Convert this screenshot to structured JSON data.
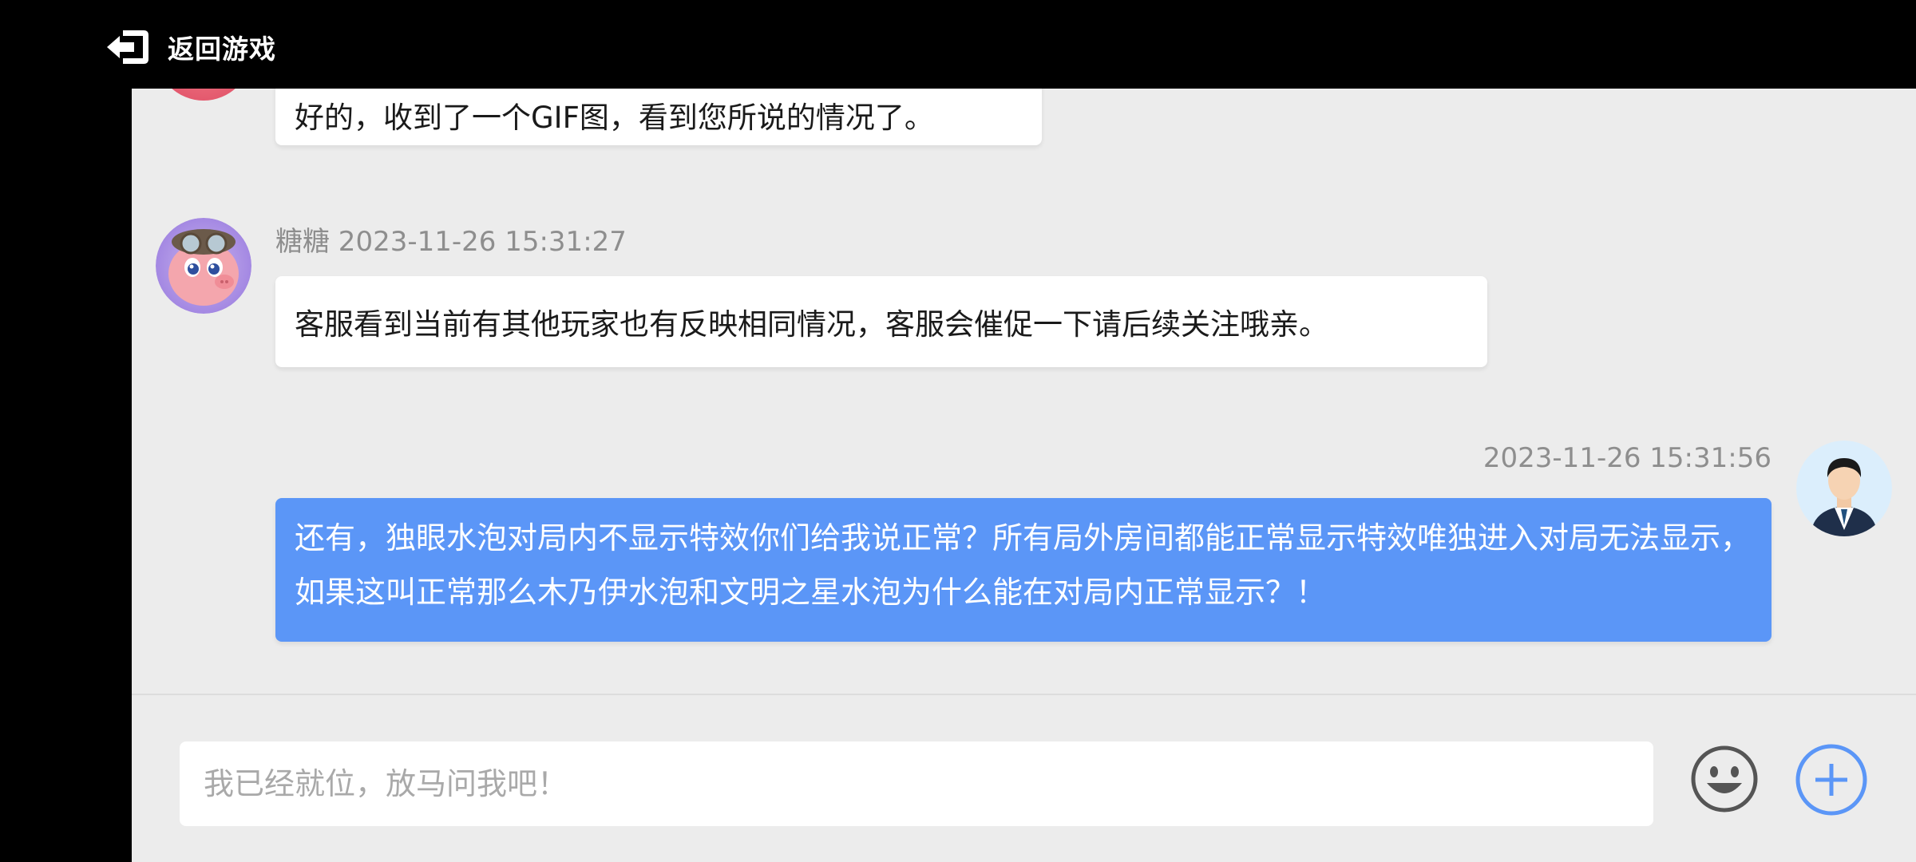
{
  "header": {
    "back_label": "返回游戏",
    "back_icon": "exit-arrow-icon"
  },
  "messages": [
    {
      "sender": "agent",
      "text": "好的，收到了一个GIF图，看到您所说的情况了。",
      "partially_visible": true
    },
    {
      "sender": "agent",
      "name": "糖糖",
      "timestamp": "2023-11-26 15:31:27",
      "meta": "糖糖 2023-11-26 15:31:27",
      "text": "客服看到当前有其他玩家也有反映相同情况，客服会催促一下请后续关注哦亲。",
      "avatar": "pig-character-avatar"
    },
    {
      "sender": "user",
      "timestamp": "2023-11-26 15:31:56",
      "text": "还有，独眼水泡对局内不显示特效你们给我说正常？所有局外房间都能正常显示特效唯独进入对局无法显示，如果这叫正常那么木乃伊水泡和文明之星水泡为什么能在对局内正常显示？！",
      "avatar": "businessman-avatar"
    }
  ],
  "composer": {
    "placeholder": "我已经就位，放马问我吧！",
    "value": "",
    "emoji_icon": "smiley-face-icon",
    "plus_icon": "plus-circle-icon"
  },
  "colors": {
    "chat_background": "#ececec",
    "user_bubble": "#5b96f7",
    "agent_bubble": "#ffffff",
    "plus_accent": "#5b96f7",
    "top_bar": "#000000"
  }
}
